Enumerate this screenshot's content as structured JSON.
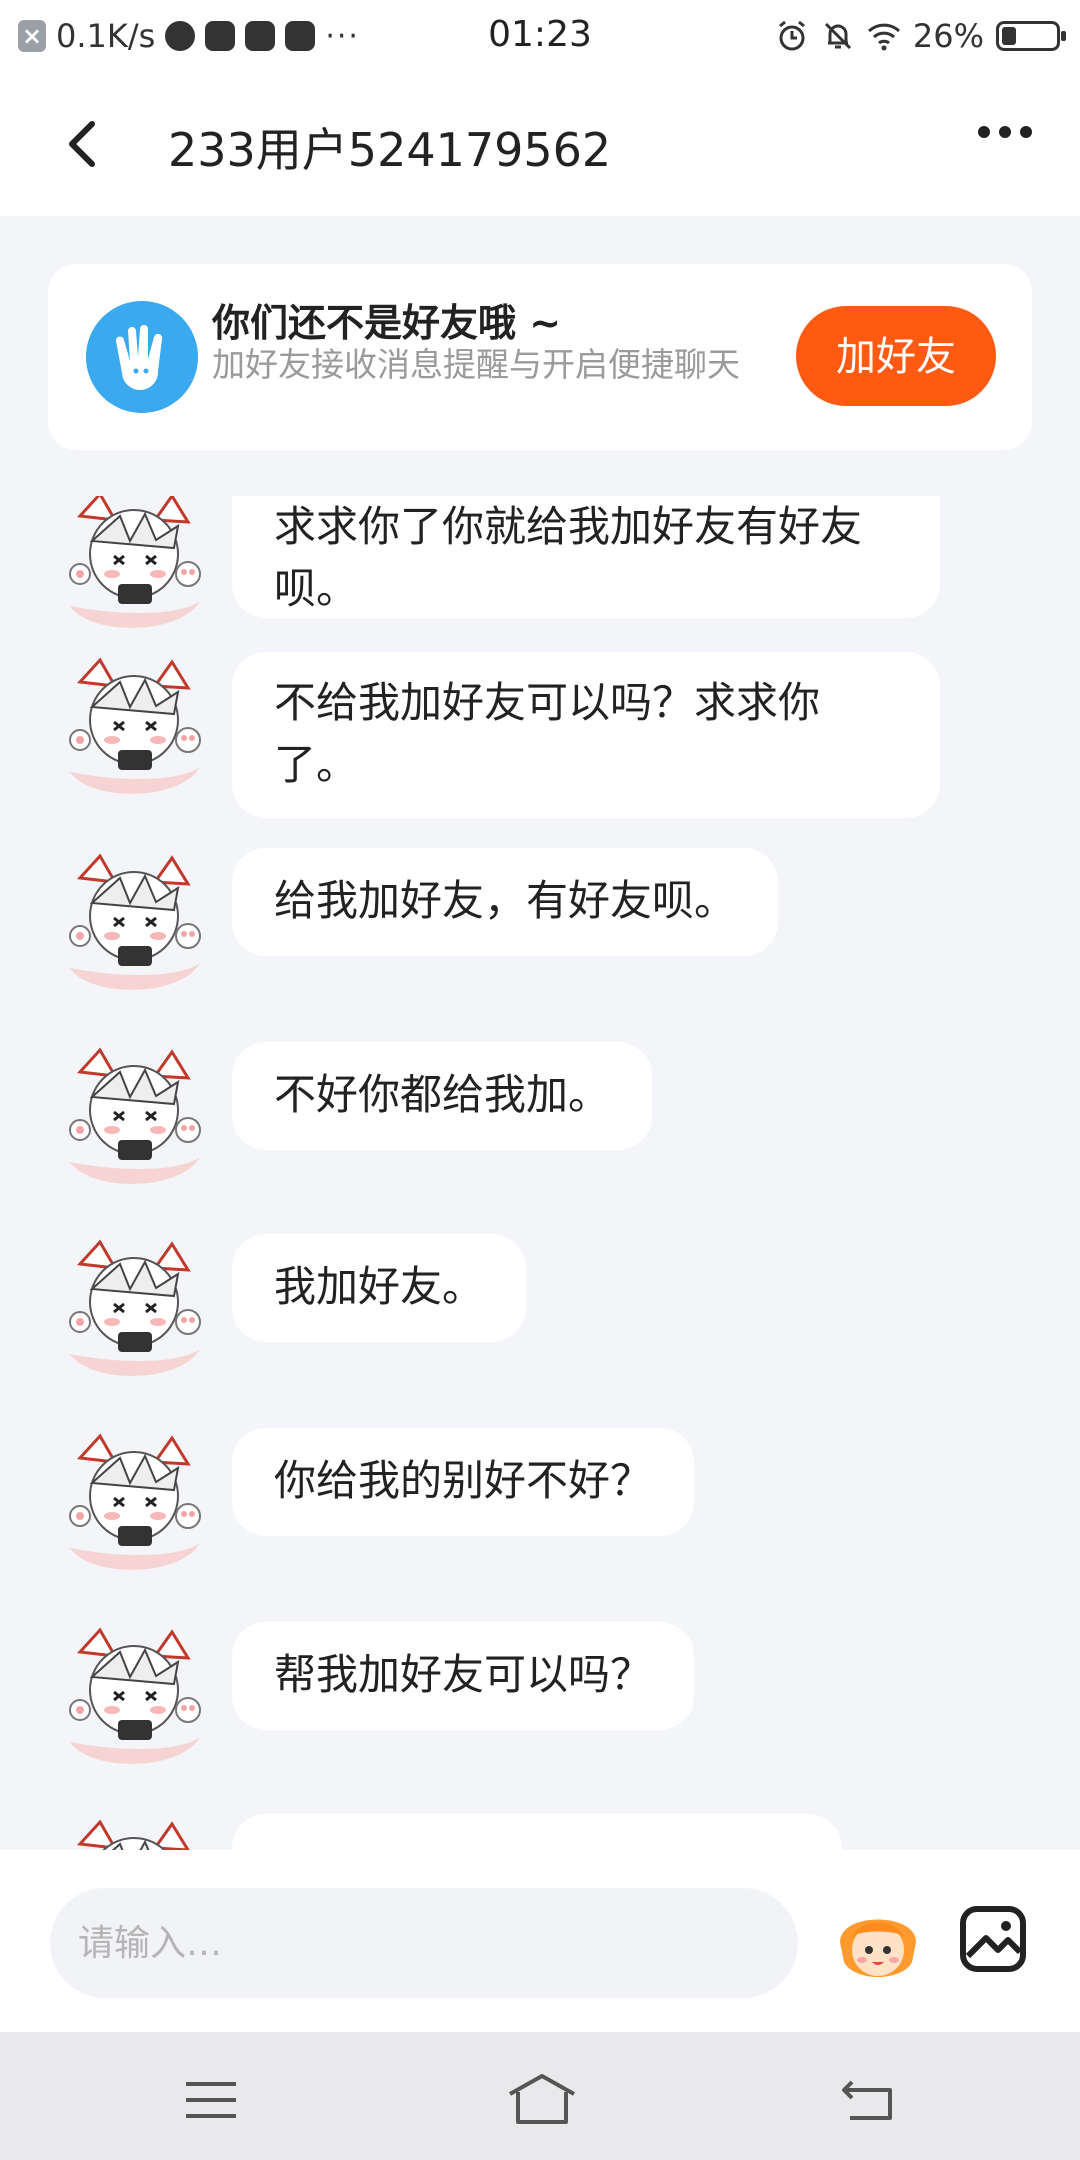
{
  "status_bar": {
    "speed": "0.1K/s",
    "time": "01:23",
    "battery": "26%",
    "battery_level": 0.26,
    "icons": [
      "close-notification-icon",
      "browser-icon",
      "video-app-icon",
      "vivo-icon",
      "tiktok-icon",
      "more-dots-icon",
      "alarm-icon",
      "mute-bell-icon",
      "wifi-icon",
      "battery-icon"
    ]
  },
  "header": {
    "title": "233用户524179562",
    "back_icon": "chevron-left-icon",
    "more_icon": "more-icon"
  },
  "friend_card": {
    "title": "你们还不是好友哦 ~",
    "subtitle": "加好友接收消息提醒与开启便捷聊天",
    "button": "加好友",
    "icon": "waving-hand-icon",
    "accent": "#ff5a12"
  },
  "messages": [
    {
      "text": "求求你了你就给我加好友有好友呗。"
    },
    {
      "text": "不给我加好友可以吗？求求你了。"
    },
    {
      "text": "给我加好友，有好友呗。"
    },
    {
      "text": "不好你都给我加。"
    },
    {
      "text": "我加好友。"
    },
    {
      "text": "你给我的别好不好？"
    },
    {
      "text": "帮我加好友可以吗？"
    },
    {
      "text": ""
    }
  ],
  "input": {
    "placeholder": "请输入…",
    "emoji_icon": "emoji-character-icon",
    "image_icon": "image-icon"
  },
  "navbar": {
    "icons": [
      "menu-icon",
      "home-icon",
      "back-icon"
    ]
  }
}
